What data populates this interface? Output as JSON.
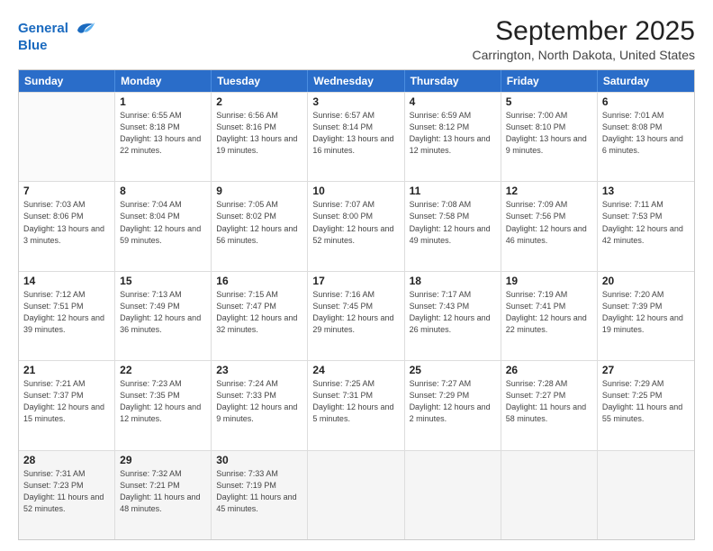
{
  "header": {
    "logo_line1": "General",
    "logo_line2": "Blue",
    "main_title": "September 2025",
    "subtitle": "Carrington, North Dakota, United States"
  },
  "days_of_week": [
    "Sunday",
    "Monday",
    "Tuesday",
    "Wednesday",
    "Thursday",
    "Friday",
    "Saturday"
  ],
  "weeks": [
    [
      {
        "day": "",
        "empty": true
      },
      {
        "day": "1",
        "rise": "6:55 AM",
        "set": "8:18 PM",
        "daylight": "13 hours and 22 minutes."
      },
      {
        "day": "2",
        "rise": "6:56 AM",
        "set": "8:16 PM",
        "daylight": "13 hours and 19 minutes."
      },
      {
        "day": "3",
        "rise": "6:57 AM",
        "set": "8:14 PM",
        "daylight": "13 hours and 16 minutes."
      },
      {
        "day": "4",
        "rise": "6:59 AM",
        "set": "8:12 PM",
        "daylight": "13 hours and 12 minutes."
      },
      {
        "day": "5",
        "rise": "7:00 AM",
        "set": "8:10 PM",
        "daylight": "13 hours and 9 minutes."
      },
      {
        "day": "6",
        "rise": "7:01 AM",
        "set": "8:08 PM",
        "daylight": "13 hours and 6 minutes."
      }
    ],
    [
      {
        "day": "7",
        "rise": "7:03 AM",
        "set": "8:06 PM",
        "daylight": "13 hours and 3 minutes."
      },
      {
        "day": "8",
        "rise": "7:04 AM",
        "set": "8:04 PM",
        "daylight": "12 hours and 59 minutes."
      },
      {
        "day": "9",
        "rise": "7:05 AM",
        "set": "8:02 PM",
        "daylight": "12 hours and 56 minutes."
      },
      {
        "day": "10",
        "rise": "7:07 AM",
        "set": "8:00 PM",
        "daylight": "12 hours and 52 minutes."
      },
      {
        "day": "11",
        "rise": "7:08 AM",
        "set": "7:58 PM",
        "daylight": "12 hours and 49 minutes."
      },
      {
        "day": "12",
        "rise": "7:09 AM",
        "set": "7:56 PM",
        "daylight": "12 hours and 46 minutes."
      },
      {
        "day": "13",
        "rise": "7:11 AM",
        "set": "7:53 PM",
        "daylight": "12 hours and 42 minutes."
      }
    ],
    [
      {
        "day": "14",
        "rise": "7:12 AM",
        "set": "7:51 PM",
        "daylight": "12 hours and 39 minutes."
      },
      {
        "day": "15",
        "rise": "7:13 AM",
        "set": "7:49 PM",
        "daylight": "12 hours and 36 minutes."
      },
      {
        "day": "16",
        "rise": "7:15 AM",
        "set": "7:47 PM",
        "daylight": "12 hours and 32 minutes."
      },
      {
        "day": "17",
        "rise": "7:16 AM",
        "set": "7:45 PM",
        "daylight": "12 hours and 29 minutes."
      },
      {
        "day": "18",
        "rise": "7:17 AM",
        "set": "7:43 PM",
        "daylight": "12 hours and 26 minutes."
      },
      {
        "day": "19",
        "rise": "7:19 AM",
        "set": "7:41 PM",
        "daylight": "12 hours and 22 minutes."
      },
      {
        "day": "20",
        "rise": "7:20 AM",
        "set": "7:39 PM",
        "daylight": "12 hours and 19 minutes."
      }
    ],
    [
      {
        "day": "21",
        "rise": "7:21 AM",
        "set": "7:37 PM",
        "daylight": "12 hours and 15 minutes."
      },
      {
        "day": "22",
        "rise": "7:23 AM",
        "set": "7:35 PM",
        "daylight": "12 hours and 12 minutes."
      },
      {
        "day": "23",
        "rise": "7:24 AM",
        "set": "7:33 PM",
        "daylight": "12 hours and 9 minutes."
      },
      {
        "day": "24",
        "rise": "7:25 AM",
        "set": "7:31 PM",
        "daylight": "12 hours and 5 minutes."
      },
      {
        "day": "25",
        "rise": "7:27 AM",
        "set": "7:29 PM",
        "daylight": "12 hours and 2 minutes."
      },
      {
        "day": "26",
        "rise": "7:28 AM",
        "set": "7:27 PM",
        "daylight": "11 hours and 58 minutes."
      },
      {
        "day": "27",
        "rise": "7:29 AM",
        "set": "7:25 PM",
        "daylight": "11 hours and 55 minutes."
      }
    ],
    [
      {
        "day": "28",
        "rise": "7:31 AM",
        "set": "7:23 PM",
        "daylight": "11 hours and 52 minutes."
      },
      {
        "day": "29",
        "rise": "7:32 AM",
        "set": "7:21 PM",
        "daylight": "11 hours and 48 minutes."
      },
      {
        "day": "30",
        "rise": "7:33 AM",
        "set": "7:19 PM",
        "daylight": "11 hours and 45 minutes."
      },
      {
        "day": "",
        "empty": true
      },
      {
        "day": "",
        "empty": true
      },
      {
        "day": "",
        "empty": true
      },
      {
        "day": "",
        "empty": true
      }
    ]
  ]
}
